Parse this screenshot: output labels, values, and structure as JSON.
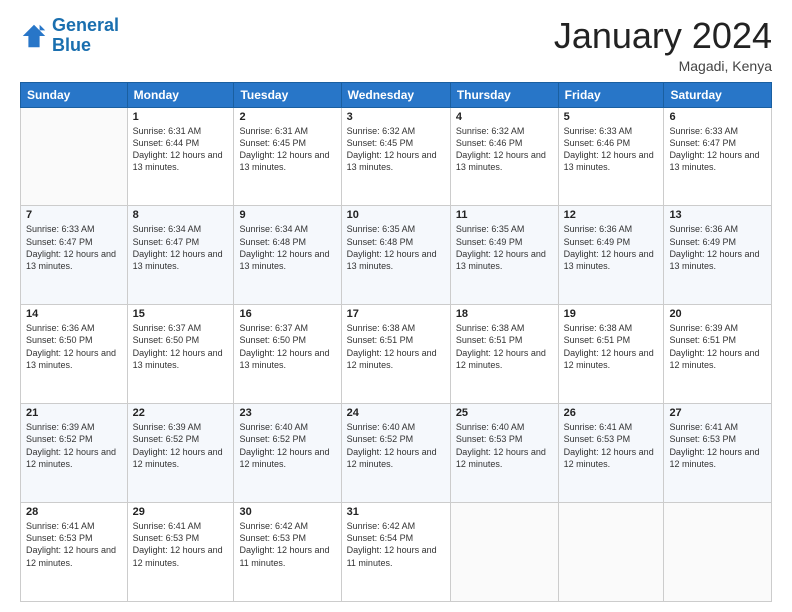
{
  "logo": {
    "line1": "General",
    "line2": "Blue"
  },
  "title": "January 2024",
  "location": "Magadi, Kenya",
  "header_days": [
    "Sunday",
    "Monday",
    "Tuesday",
    "Wednesday",
    "Thursday",
    "Friday",
    "Saturday"
  ],
  "weeks": [
    [
      {
        "day": "",
        "sunrise": "",
        "sunset": "",
        "daylight": ""
      },
      {
        "day": "1",
        "sunrise": "Sunrise: 6:31 AM",
        "sunset": "Sunset: 6:44 PM",
        "daylight": "Daylight: 12 hours and 13 minutes."
      },
      {
        "day": "2",
        "sunrise": "Sunrise: 6:31 AM",
        "sunset": "Sunset: 6:45 PM",
        "daylight": "Daylight: 12 hours and 13 minutes."
      },
      {
        "day": "3",
        "sunrise": "Sunrise: 6:32 AM",
        "sunset": "Sunset: 6:45 PM",
        "daylight": "Daylight: 12 hours and 13 minutes."
      },
      {
        "day": "4",
        "sunrise": "Sunrise: 6:32 AM",
        "sunset": "Sunset: 6:46 PM",
        "daylight": "Daylight: 12 hours and 13 minutes."
      },
      {
        "day": "5",
        "sunrise": "Sunrise: 6:33 AM",
        "sunset": "Sunset: 6:46 PM",
        "daylight": "Daylight: 12 hours and 13 minutes."
      },
      {
        "day": "6",
        "sunrise": "Sunrise: 6:33 AM",
        "sunset": "Sunset: 6:47 PM",
        "daylight": "Daylight: 12 hours and 13 minutes."
      }
    ],
    [
      {
        "day": "7",
        "sunrise": "Sunrise: 6:33 AM",
        "sunset": "Sunset: 6:47 PM",
        "daylight": "Daylight: 12 hours and 13 minutes."
      },
      {
        "day": "8",
        "sunrise": "Sunrise: 6:34 AM",
        "sunset": "Sunset: 6:47 PM",
        "daylight": "Daylight: 12 hours and 13 minutes."
      },
      {
        "day": "9",
        "sunrise": "Sunrise: 6:34 AM",
        "sunset": "Sunset: 6:48 PM",
        "daylight": "Daylight: 12 hours and 13 minutes."
      },
      {
        "day": "10",
        "sunrise": "Sunrise: 6:35 AM",
        "sunset": "Sunset: 6:48 PM",
        "daylight": "Daylight: 12 hours and 13 minutes."
      },
      {
        "day": "11",
        "sunrise": "Sunrise: 6:35 AM",
        "sunset": "Sunset: 6:49 PM",
        "daylight": "Daylight: 12 hours and 13 minutes."
      },
      {
        "day": "12",
        "sunrise": "Sunrise: 6:36 AM",
        "sunset": "Sunset: 6:49 PM",
        "daylight": "Daylight: 12 hours and 13 minutes."
      },
      {
        "day": "13",
        "sunrise": "Sunrise: 6:36 AM",
        "sunset": "Sunset: 6:49 PM",
        "daylight": "Daylight: 12 hours and 13 minutes."
      }
    ],
    [
      {
        "day": "14",
        "sunrise": "Sunrise: 6:36 AM",
        "sunset": "Sunset: 6:50 PM",
        "daylight": "Daylight: 12 hours and 13 minutes."
      },
      {
        "day": "15",
        "sunrise": "Sunrise: 6:37 AM",
        "sunset": "Sunset: 6:50 PM",
        "daylight": "Daylight: 12 hours and 13 minutes."
      },
      {
        "day": "16",
        "sunrise": "Sunrise: 6:37 AM",
        "sunset": "Sunset: 6:50 PM",
        "daylight": "Daylight: 12 hours and 13 minutes."
      },
      {
        "day": "17",
        "sunrise": "Sunrise: 6:38 AM",
        "sunset": "Sunset: 6:51 PM",
        "daylight": "Daylight: 12 hours and 12 minutes."
      },
      {
        "day": "18",
        "sunrise": "Sunrise: 6:38 AM",
        "sunset": "Sunset: 6:51 PM",
        "daylight": "Daylight: 12 hours and 12 minutes."
      },
      {
        "day": "19",
        "sunrise": "Sunrise: 6:38 AM",
        "sunset": "Sunset: 6:51 PM",
        "daylight": "Daylight: 12 hours and 12 minutes."
      },
      {
        "day": "20",
        "sunrise": "Sunrise: 6:39 AM",
        "sunset": "Sunset: 6:51 PM",
        "daylight": "Daylight: 12 hours and 12 minutes."
      }
    ],
    [
      {
        "day": "21",
        "sunrise": "Sunrise: 6:39 AM",
        "sunset": "Sunset: 6:52 PM",
        "daylight": "Daylight: 12 hours and 12 minutes."
      },
      {
        "day": "22",
        "sunrise": "Sunrise: 6:39 AM",
        "sunset": "Sunset: 6:52 PM",
        "daylight": "Daylight: 12 hours and 12 minutes."
      },
      {
        "day": "23",
        "sunrise": "Sunrise: 6:40 AM",
        "sunset": "Sunset: 6:52 PM",
        "daylight": "Daylight: 12 hours and 12 minutes."
      },
      {
        "day": "24",
        "sunrise": "Sunrise: 6:40 AM",
        "sunset": "Sunset: 6:52 PM",
        "daylight": "Daylight: 12 hours and 12 minutes."
      },
      {
        "day": "25",
        "sunrise": "Sunrise: 6:40 AM",
        "sunset": "Sunset: 6:53 PM",
        "daylight": "Daylight: 12 hours and 12 minutes."
      },
      {
        "day": "26",
        "sunrise": "Sunrise: 6:41 AM",
        "sunset": "Sunset: 6:53 PM",
        "daylight": "Daylight: 12 hours and 12 minutes."
      },
      {
        "day": "27",
        "sunrise": "Sunrise: 6:41 AM",
        "sunset": "Sunset: 6:53 PM",
        "daylight": "Daylight: 12 hours and 12 minutes."
      }
    ],
    [
      {
        "day": "28",
        "sunrise": "Sunrise: 6:41 AM",
        "sunset": "Sunset: 6:53 PM",
        "daylight": "Daylight: 12 hours and 12 minutes."
      },
      {
        "day": "29",
        "sunrise": "Sunrise: 6:41 AM",
        "sunset": "Sunset: 6:53 PM",
        "daylight": "Daylight: 12 hours and 12 minutes."
      },
      {
        "day": "30",
        "sunrise": "Sunrise: 6:42 AM",
        "sunset": "Sunset: 6:53 PM",
        "daylight": "Daylight: 12 hours and 11 minutes."
      },
      {
        "day": "31",
        "sunrise": "Sunrise: 6:42 AM",
        "sunset": "Sunset: 6:54 PM",
        "daylight": "Daylight: 12 hours and 11 minutes."
      },
      {
        "day": "",
        "sunrise": "",
        "sunset": "",
        "daylight": ""
      },
      {
        "day": "",
        "sunrise": "",
        "sunset": "",
        "daylight": ""
      },
      {
        "day": "",
        "sunrise": "",
        "sunset": "",
        "daylight": ""
      }
    ]
  ]
}
